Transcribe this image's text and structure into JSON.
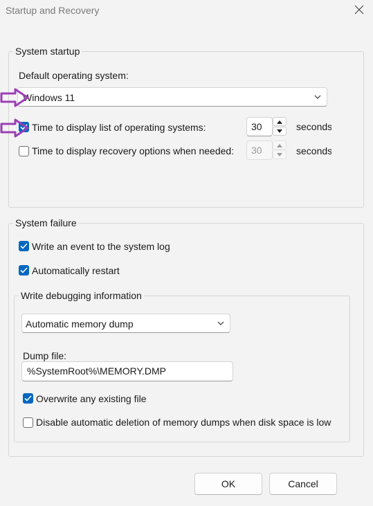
{
  "window": {
    "title": "Startup and Recovery"
  },
  "system_startup": {
    "legend": "System startup",
    "default_os_label": "Default operating system:",
    "default_os_value": "Windows 11",
    "display_list": {
      "label": "Time to display list of operating systems:",
      "checked": true,
      "value": "30",
      "unit": "seconds"
    },
    "display_recovery": {
      "label": "Time to display recovery options when needed:",
      "checked": false,
      "value": "30",
      "unit": "seconds"
    }
  },
  "system_failure": {
    "legend": "System failure",
    "write_event": {
      "label": "Write an event to the system log",
      "checked": true
    },
    "auto_restart": {
      "label": "Automatically restart",
      "checked": true
    },
    "debugging": {
      "legend": "Write debugging information",
      "dump_type": "Automatic memory dump",
      "dump_file_label": "Dump file:",
      "dump_file_value": "%SystemRoot%\\MEMORY.DMP",
      "overwrite": {
        "label": "Overwrite any existing file",
        "checked": true
      },
      "disable_auto_delete": {
        "label": "Disable automatic deletion of memory dumps when disk space is low",
        "checked": false
      }
    }
  },
  "buttons": {
    "ok": "OK",
    "cancel": "Cancel"
  },
  "annotation": {
    "arrow_color": "#9b3fb5"
  },
  "icons": [
    "close-icon",
    "chevron-down-icon",
    "checkmark-icon",
    "spin-up-icon",
    "spin-down-icon",
    "arrow-annotation-icon"
  ]
}
